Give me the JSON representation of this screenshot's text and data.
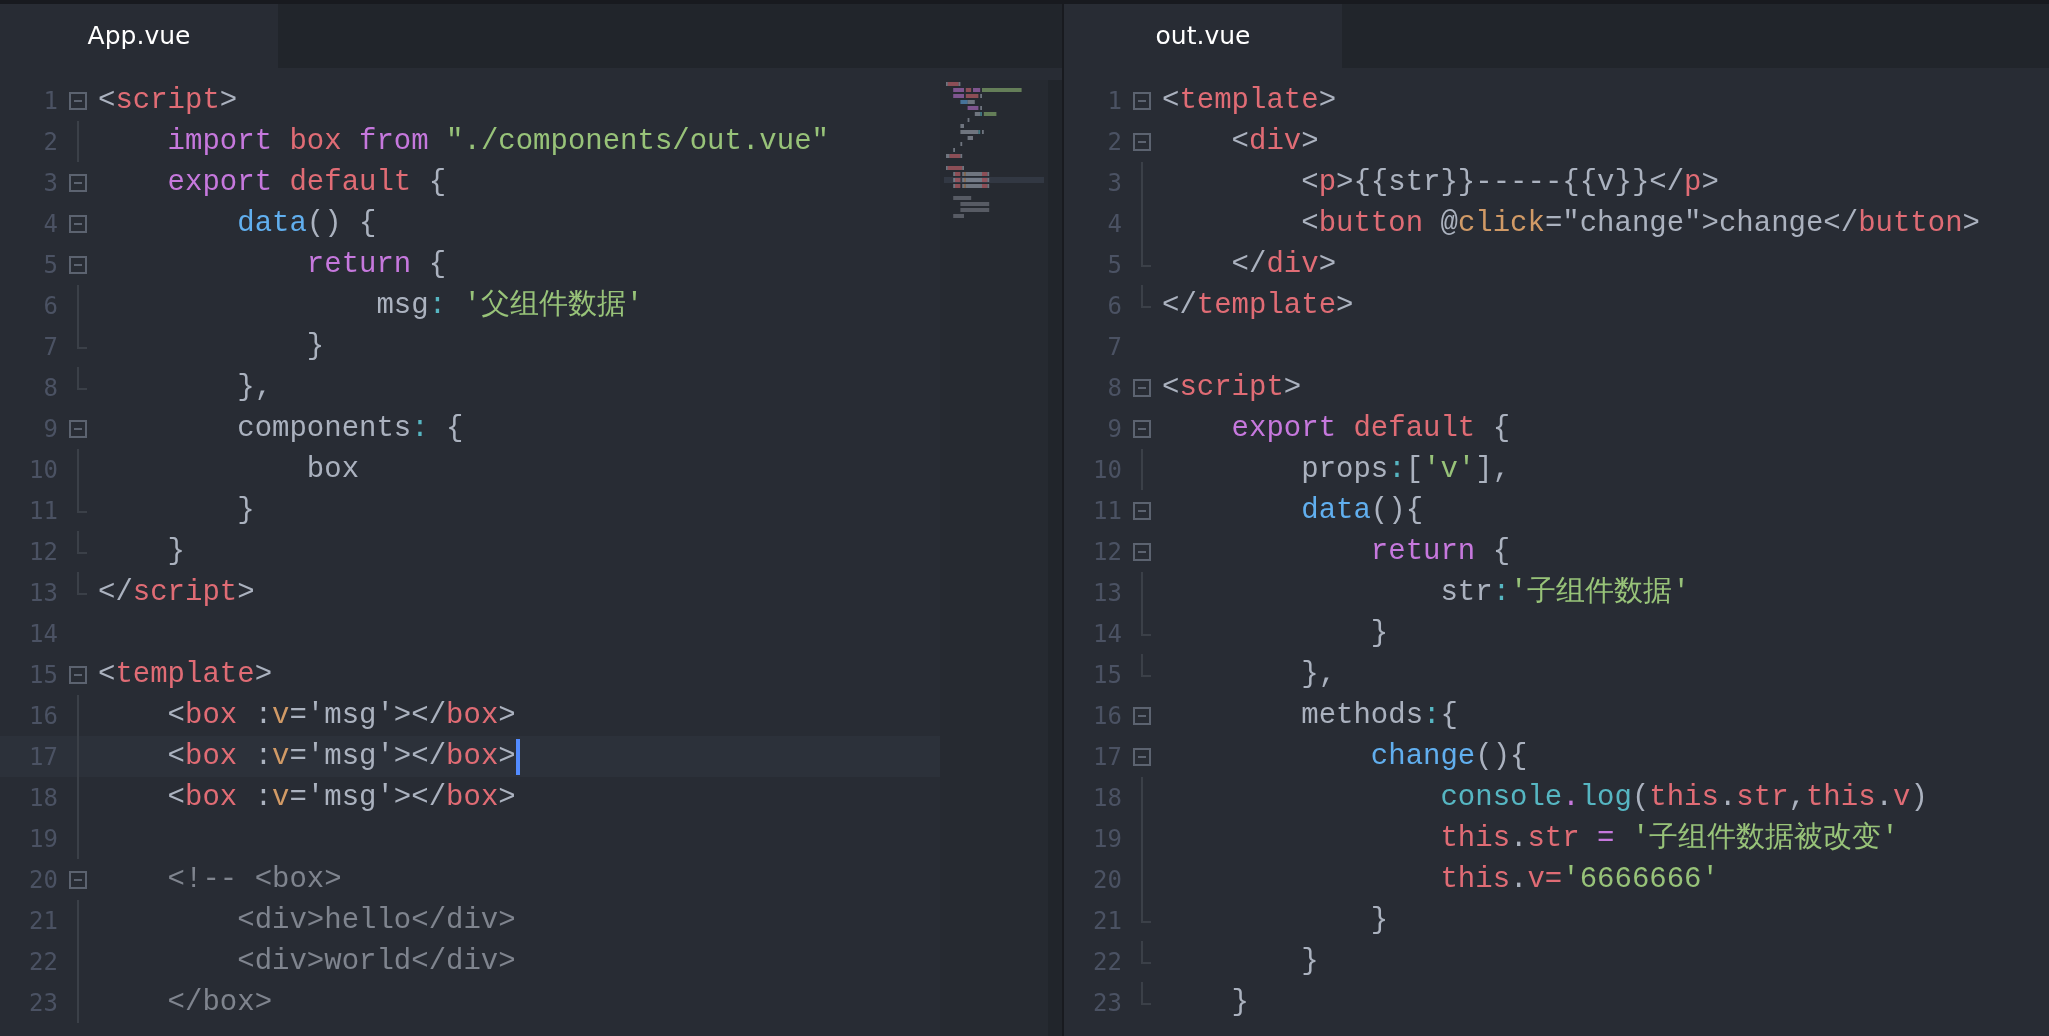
{
  "panes": [
    {
      "tab": {
        "label": "App.vue",
        "selected": true
      },
      "minimap": true,
      "lines": [
        {
          "number": "1",
          "kind": "start",
          "tokens": [
            {
              "kind": "punct",
              "text": "<"
            },
            {
              "kind": "tag",
              "text": "script"
            },
            {
              "kind": "punct",
              "text": ">"
            }
          ]
        },
        {
          "number": "2",
          "kind": "inside",
          "tokens": [
            {
              "kind": "keyword",
              "text": "    import"
            },
            {
              "kind": "variable",
              "text": " box"
            },
            {
              "kind": "keyword",
              "text": " from"
            },
            {
              "kind": "string",
              "text": " \"./components/out.vue\""
            }
          ]
        },
        {
          "number": "3",
          "kind": "start",
          "tokens": [
            {
              "kind": "keyword",
              "text": "    export"
            },
            {
              "kind": "variable",
              "text": " default"
            },
            {
              "kind": "punct",
              "text": " {"
            }
          ]
        },
        {
          "number": "4",
          "kind": "start",
          "tokens": [
            {
              "kind": "function",
              "text": "        data"
            },
            {
              "kind": "punct",
              "text": "() {"
            }
          ]
        },
        {
          "number": "5",
          "kind": "start",
          "tokens": [
            {
              "kind": "keyword",
              "text": "            return"
            },
            {
              "kind": "punct",
              "text": " {"
            }
          ]
        },
        {
          "number": "6",
          "kind": "inside",
          "tokens": [
            {
              "kind": "plain",
              "text": "                msg"
            },
            {
              "kind": "colon",
              "text": ":"
            },
            {
              "kind": "string",
              "text": " '父组件数据'"
            }
          ]
        },
        {
          "number": "7",
          "kind": "end",
          "tokens": [
            {
              "kind": "punct",
              "text": "            }"
            }
          ]
        },
        {
          "number": "8",
          "kind": "end",
          "tokens": [
            {
              "kind": "punct",
              "text": "        },"
            }
          ]
        },
        {
          "number": "9",
          "kind": "start",
          "tokens": [
            {
              "kind": "plain",
              "text": "        components"
            },
            {
              "kind": "colon",
              "text": ":"
            },
            {
              "kind": "punct",
              "text": " {"
            }
          ]
        },
        {
          "number": "10",
          "kind": "inside",
          "tokens": [
            {
              "kind": "plain",
              "text": "            box"
            }
          ]
        },
        {
          "number": "11",
          "kind": "end",
          "tokens": [
            {
              "kind": "punct",
              "text": "        }"
            }
          ]
        },
        {
          "number": "12",
          "kind": "end",
          "tokens": [
            {
              "kind": "punct",
              "text": "    }"
            }
          ]
        },
        {
          "number": "13",
          "kind": "end",
          "tokens": [
            {
              "kind": "punct",
              "text": "</"
            },
            {
              "kind": "tag",
              "text": "script"
            },
            {
              "kind": "punct",
              "text": ">"
            }
          ]
        },
        {
          "number": "14",
          "kind": "none"
        },
        {
          "number": "15",
          "kind": "start",
          "tokens": [
            {
              "kind": "punct",
              "text": "<"
            },
            {
              "kind": "tag",
              "text": "template"
            },
            {
              "kind": "punct",
              "text": ">"
            }
          ]
        },
        {
          "number": "16",
          "kind": "inside",
          "tokens": [
            {
              "kind": "punct",
              "text": "    <"
            },
            {
              "kind": "tag",
              "text": "box"
            },
            {
              "kind": "punct",
              "text": " :"
            },
            {
              "kind": "attribute",
              "text": "v"
            },
            {
              "kind": "punct",
              "text": "='msg'></"
            },
            {
              "kind": "tag",
              "text": "box"
            },
            {
              "kind": "punct",
              "text": ">"
            }
          ]
        },
        {
          "number": "17",
          "kind": "inside",
          "current": true,
          "tokens": [
            {
              "kind": "punct",
              "text": "    <"
            },
            {
              "kind": "tag",
              "text": "box"
            },
            {
              "kind": "punct",
              "text": " :"
            },
            {
              "kind": "attribute",
              "text": "v"
            },
            {
              "kind": "punct",
              "text": "='msg'></"
            },
            {
              "kind": "tag",
              "text": "box"
            },
            {
              "kind": "punct",
              "text": ">"
            }
          ]
        },
        {
          "number": "18",
          "kind": "inside",
          "tokens": [
            {
              "kind": "punct",
              "text": "    <"
            },
            {
              "kind": "tag",
              "text": "box"
            },
            {
              "kind": "punct",
              "text": " :"
            },
            {
              "kind": "attribute",
              "text": "v"
            },
            {
              "kind": "punct",
              "text": "='msg'></"
            },
            {
              "kind": "tag",
              "text": "box"
            },
            {
              "kind": "punct",
              "text": ">"
            }
          ]
        },
        {
          "number": "19",
          "kind": "inside"
        },
        {
          "number": "20",
          "kind": "start",
          "tokens": [
            {
              "kind": "comment",
              "text": "    <!-- <box>"
            }
          ]
        },
        {
          "number": "21",
          "kind": "inside",
          "tokens": [
            {
              "kind": "comment",
              "text": "        <div>hello</div>"
            }
          ]
        },
        {
          "number": "22",
          "kind": "inside",
          "tokens": [
            {
              "kind": "comment",
              "text": "        <div>world</div>"
            }
          ]
        },
        {
          "number": "23",
          "kind": "inside",
          "tokens": [
            {
              "kind": "comment",
              "text": "    </box>"
            }
          ]
        }
      ]
    },
    {
      "tab": {
        "label": "out.vue",
        "selected": true
      },
      "lines": [
        {
          "number": "1",
          "kind": "start",
          "tokens": [
            {
              "kind": "punct",
              "text": "<"
            },
            {
              "kind": "tag",
              "text": "template"
            },
            {
              "kind": "punct",
              "text": ">"
            }
          ]
        },
        {
          "number": "2",
          "kind": "start",
          "tokens": [
            {
              "kind": "punct",
              "text": "    <"
            },
            {
              "kind": "tag",
              "text": "div"
            },
            {
              "kind": "punct",
              "text": ">"
            }
          ]
        },
        {
          "number": "3",
          "kind": "inside",
          "tokens": [
            {
              "kind": "punct",
              "text": "        <"
            },
            {
              "kind": "tag",
              "text": "p"
            },
            {
              "kind": "punct",
              "text": ">{{str}}-----{{v}}</"
            },
            {
              "kind": "tag",
              "text": "p"
            },
            {
              "kind": "punct",
              "text": ">"
            }
          ]
        },
        {
          "number": "4",
          "kind": "inside",
          "tokens": [
            {
              "kind": "punct",
              "text": "        <"
            },
            {
              "kind": "tag",
              "text": "button"
            },
            {
              "kind": "punct",
              "text": " @"
            },
            {
              "kind": "attribute",
              "text": "click"
            },
            {
              "kind": "punct",
              "text": "=\"change\">change</"
            },
            {
              "kind": "tag",
              "text": "button"
            },
            {
              "kind": "punct",
              "text": ">"
            }
          ]
        },
        {
          "number": "5",
          "kind": "end",
          "tokens": [
            {
              "kind": "punct",
              "text": "    </"
            },
            {
              "kind": "tag",
              "text": "div"
            },
            {
              "kind": "punct",
              "text": ">"
            }
          ]
        },
        {
          "number": "6",
          "kind": "end",
          "tokens": [
            {
              "kind": "punct",
              "text": "</"
            },
            {
              "kind": "tag",
              "text": "template"
            },
            {
              "kind": "punct",
              "text": ">"
            }
          ]
        },
        {
          "number": "7",
          "kind": "none"
        },
        {
          "number": "8",
          "kind": "start",
          "tokens": [
            {
              "kind": "punct",
              "text": "<"
            },
            {
              "kind": "tag",
              "text": "script"
            },
            {
              "kind": "punct",
              "text": ">"
            }
          ]
        },
        {
          "number": "9",
          "kind": "start",
          "tokens": [
            {
              "kind": "keyword",
              "text": "    export"
            },
            {
              "kind": "variable",
              "text": " default"
            },
            {
              "kind": "punct",
              "text": " {"
            }
          ]
        },
        {
          "number": "10",
          "kind": "inside",
          "tokens": [
            {
              "kind": "plain",
              "text": "        props"
            },
            {
              "kind": "colon",
              "text": ":"
            },
            {
              "kind": "punct",
              "text": "["
            },
            {
              "kind": "string",
              "text": "'v'"
            },
            {
              "kind": "punct",
              "text": "],"
            }
          ]
        },
        {
          "number": "11",
          "kind": "start",
          "tokens": [
            {
              "kind": "function",
              "text": "        data"
            },
            {
              "kind": "punct",
              "text": "(){"
            }
          ]
        },
        {
          "number": "12",
          "kind": "start",
          "tokens": [
            {
              "kind": "keyword",
              "text": "            return"
            },
            {
              "kind": "punct",
              "text": " {"
            }
          ]
        },
        {
          "number": "13",
          "kind": "inside",
          "tokens": [
            {
              "kind": "plain",
              "text": "                str"
            },
            {
              "kind": "colon",
              "text": ":"
            },
            {
              "kind": "string",
              "text": "'子组件数据'"
            }
          ]
        },
        {
          "number": "14",
          "kind": "end",
          "tokens": [
            {
              "kind": "punct",
              "text": "            }"
            }
          ]
        },
        {
          "number": "15",
          "kind": "end",
          "tokens": [
            {
              "kind": "punct",
              "text": "        },"
            }
          ]
        },
        {
          "number": "16",
          "kind": "start",
          "tokens": [
            {
              "kind": "plain",
              "text": "        methods"
            },
            {
              "kind": "colon",
              "text": ":"
            },
            {
              "kind": "punct",
              "text": "{"
            }
          ]
        },
        {
          "number": "17",
          "kind": "start",
          "tokens": [
            {
              "kind": "function",
              "text": "            change"
            },
            {
              "kind": "punct",
              "text": "(){"
            }
          ]
        },
        {
          "number": "18",
          "kind": "inside",
          "tokens": [
            {
              "kind": "builtin",
              "text": "                console"
            },
            {
              "kind": "operator",
              "text": "."
            },
            {
              "kind": "builtin",
              "text": "log"
            },
            {
              "kind": "punct",
              "text": "("
            },
            {
              "kind": "variable",
              "text": "this"
            },
            {
              "kind": "punct",
              "text": "."
            },
            {
              "kind": "variable",
              "text": "str"
            },
            {
              "kind": "punct",
              "text": ","
            },
            {
              "kind": "variable",
              "text": "this"
            },
            {
              "kind": "punct",
              "text": "."
            },
            {
              "kind": "variable",
              "text": "v"
            },
            {
              "kind": "punct",
              "text": ")"
            }
          ]
        },
        {
          "number": "19",
          "kind": "inside",
          "tokens": [
            {
              "kind": "variable",
              "text": "                this"
            },
            {
              "kind": "punct",
              "text": "."
            },
            {
              "kind": "variable",
              "text": "str"
            },
            {
              "kind": "operator",
              "text": " ="
            },
            {
              "kind": "string",
              "text": " '子组件数据被改变'"
            }
          ]
        },
        {
          "number": "20",
          "kind": "inside",
          "tokens": [
            {
              "kind": "variable",
              "text": "                this"
            },
            {
              "kind": "punct",
              "text": "."
            },
            {
              "kind": "variable",
              "text": "v="
            },
            {
              "kind": "string",
              "text": "'6666666'"
            }
          ]
        },
        {
          "number": "21",
          "kind": "end",
          "tokens": [
            {
              "kind": "punct",
              "text": "            }"
            }
          ]
        },
        {
          "number": "22",
          "kind": "end",
          "tokens": [
            {
              "kind": "punct",
              "text": "        }"
            }
          ]
        },
        {
          "number": "23",
          "kind": "end",
          "tokens": [
            {
              "kind": "punct",
              "text": "    }"
            }
          ]
        }
      ]
    }
  ]
}
